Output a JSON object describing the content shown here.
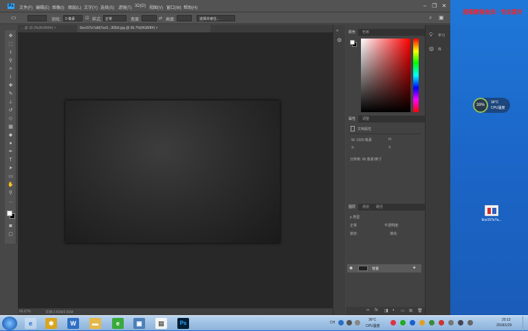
{
  "menubar": {
    "items": [
      "文件(F)",
      "编辑(E)",
      "图像(I)",
      "图层(L)",
      "文字(Y)",
      "选择(S)",
      "滤镜(T)",
      "3D(D)",
      "视图(V)",
      "窗口(W)",
      "帮助(H)"
    ],
    "logo": "Ps",
    "min": "–",
    "max": "❐",
    "close": "✕"
  },
  "options": {
    "feather_label": "羽化:",
    "feather_value": "0 像素",
    "style_label": "样式:",
    "style_value": "正常",
    "width_label": "宽度:",
    "height_label": "高度:",
    "select_mask": "选择并遮住..."
  },
  "tabs": [
    {
      "label": "... @ 33.3%(RGB/8#) ×"
    },
    {
      "label": "9ce157e7a667ec0...3f2b5.jpg @ 66.7%(RGB/8#) ×"
    }
  ],
  "status": {
    "zoom": "66.67%",
    "doc": "文档:2.81M/2.81M"
  },
  "color_panel": {
    "tabs": [
      "颜色",
      "色板"
    ]
  },
  "properties_panel": {
    "tabs": [
      "属性",
      "调整"
    ],
    "title": "文档属性",
    "w": "W: 1920 像素",
    "h": "H:",
    "x": "X:",
    "y": "Y:",
    "resolution": "分辨率: 96 像素/英寸"
  },
  "layers_panel": {
    "tabs": [
      "图层",
      "通道",
      "路径"
    ],
    "kind": "ρ 类型",
    "blend": "正常",
    "opacity": "不透明度:",
    "lock": "锁定:",
    "fill": "填充:",
    "layer_name": "背景"
  },
  "right_strip": {
    "learn": "学习",
    "libraries": "库"
  },
  "desktop": {
    "watermark": "观看教程会员 · 专业提升",
    "widget_percent": "39%",
    "widget_temp": "36°C",
    "widget_label": "CPU温度",
    "file_label": "9ce157e7a..."
  },
  "taskbar": {
    "tray_temp": "36°C",
    "tray_cpu": "CPU温度",
    "ch": "CH",
    "time": "20:13",
    "date": "2018/1/29"
  },
  "colors": {
    "accent": "#31a8ff",
    "desktop": "#1b66c8"
  }
}
